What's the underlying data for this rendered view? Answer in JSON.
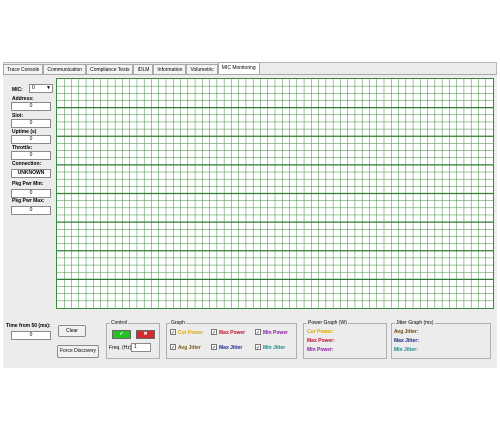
{
  "tabs": [
    "Trace Console",
    "Communication",
    "Compliance Tests",
    "IDLM",
    "Information",
    "Volumetric",
    "MIC Monitoring"
  ],
  "active_tab": "MIC Monitoring",
  "left": {
    "mic_label": "MIC:",
    "mic_value": "0",
    "address_label": "Address:",
    "address_value": "0",
    "slot_label": "Slot:",
    "slot_value": "0",
    "uptime_label": "Uptime (s)",
    "uptime_value": "0",
    "throttle_label": "Throttle:",
    "throttle_value": "0",
    "connection_label": "Connection:",
    "connection_value": "UNKNOWN",
    "pkg_pwr_min_label": "Pkg Pwr Min:",
    "pkg_pwr_min_value": "0",
    "pkg_pwr_max_label": "Pkg Pwr Max:",
    "pkg_pwr_max_value": "0",
    "time_label": "Time from 50 (ms):",
    "time_value": "0"
  },
  "buttons": {
    "clear": "Clear",
    "force_discovery": "Force Discovery"
  },
  "control": {
    "title": "Control",
    "freq_label": "Freq. (Hz)",
    "freq_value": "1",
    "led_on_color": "#22c322",
    "led_off_color": "#d42a2a"
  },
  "graph": {
    "title": "Graph",
    "items": [
      {
        "label": "Cur Power",
        "color": "#e0a800",
        "checked": true
      },
      {
        "label": "Max Power",
        "color": "#c0102a",
        "checked": true
      },
      {
        "label": "Min Power",
        "color": "#8b1aa8",
        "checked": true
      },
      {
        "label": "Avg Jitter",
        "color": "#7a5a10",
        "checked": true
      },
      {
        "label": "Max Jitter",
        "color": "#1a2a8a",
        "checked": true
      },
      {
        "label": "Min Jitter",
        "color": "#1a8a8a",
        "checked": true
      }
    ]
  },
  "power_graph": {
    "title": "Power Graph (W)",
    "items": [
      {
        "label": "Cur Power:",
        "color": "#e0a800"
      },
      {
        "label": "Max Power:",
        "color": "#c0102a"
      },
      {
        "label": "Min Power:",
        "color": "#8b1aa8"
      }
    ]
  },
  "jitter_graph": {
    "title": "Jitter Graph (ms)",
    "items": [
      {
        "label": "Avg Jitter:",
        "color": "#6b4a0a"
      },
      {
        "label": "Max Jitter:",
        "color": "#1a2a8a"
      },
      {
        "label": "Min Jitter:",
        "color": "#1a8a8a"
      }
    ]
  },
  "colors": {
    "grid_line": "#3c8a3c",
    "grid_major": "#2e7d32"
  }
}
